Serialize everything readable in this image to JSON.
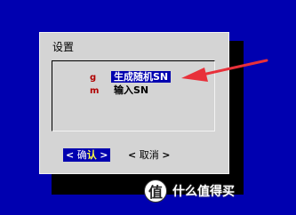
{
  "dialog": {
    "title": "设置",
    "menu": [
      {
        "hotkey": "g",
        "label": "生成随机SN",
        "selected": true
      },
      {
        "hotkey": "m",
        "label": "输入SN",
        "selected": false
      }
    ],
    "buttons": {
      "confirm": {
        "left": "<",
        "text_a": "确",
        "text_b": "认",
        "right": ">"
      },
      "cancel": {
        "left": "<",
        "text": "取消",
        "right": ">"
      }
    }
  },
  "watermark": {
    "logo_char": "值",
    "text": "什么值得买"
  },
  "colors": {
    "background": "#0000b0",
    "dialog": "#d4d4d4",
    "selection": "#0000b0",
    "hotkey": "#b00000",
    "arrow": "#e8303a"
  }
}
